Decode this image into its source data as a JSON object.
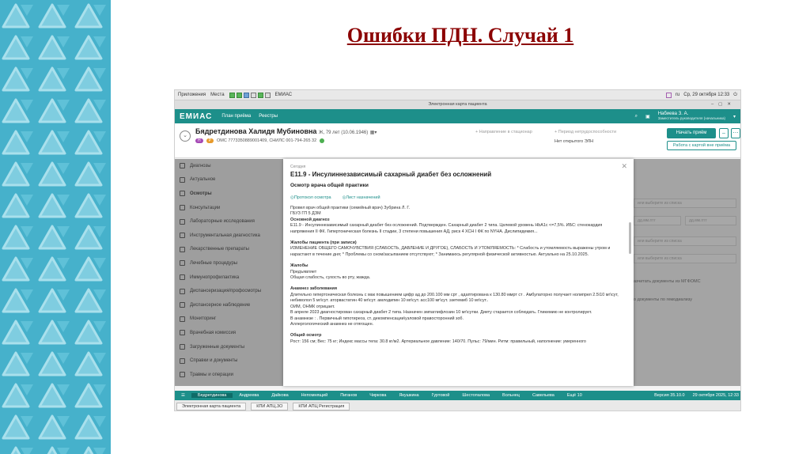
{
  "slide": {
    "title": "Ошибки ПДН. Случай 1"
  },
  "os_bar": {
    "menu": [
      "Приложения",
      "Места"
    ],
    "app_name": "ЕМИАС",
    "locale": "ru",
    "datetime": "Ср, 29 октября 12:33"
  },
  "window": {
    "title": "Электронная карта пациента"
  },
  "app": {
    "logo": "ЕМИАС",
    "nav": [
      "План приёма",
      "Реестры"
    ],
    "user_name": "Набиева З. А.",
    "user_role": "Заместитель руководителя (начальника)"
  },
  "patient": {
    "name": "Бядретдинова Халидя Мубиновна",
    "details": "Ж, 79 лет (10.06.1946)",
    "tags": [
      "Н",
      "Р"
    ],
    "policy": "ОМС 7773350889001409, СНИЛС 001-794-265 32",
    "referral_label": "+ Направление в стационар",
    "disability_label": "+ Период нетрудоспособности",
    "disability_status": "Нет открытого ЭЛН",
    "start_button": "Начать приём",
    "minus_button": "–",
    "work_button": "Работа с картой вне приёма"
  },
  "sidebar": {
    "items": [
      {
        "label": "Диагнозы",
        "active": false
      },
      {
        "label": "Актуальное",
        "active": false
      },
      {
        "label": "Осмотры",
        "active": true
      },
      {
        "label": "Консультации",
        "active": false
      },
      {
        "label": "Лабораторные исследования",
        "active": false
      },
      {
        "label": "Инструментальная диагностика",
        "active": false
      },
      {
        "label": "Лекарственные препараты",
        "active": false
      },
      {
        "label": "Лечебные процедуры",
        "active": false
      },
      {
        "label": "Иммунопрофилактика",
        "active": false
      },
      {
        "label": "Диспансеризация/профосмотры",
        "active": false
      },
      {
        "label": "Диспансерное наблюдение",
        "active": false
      },
      {
        "label": "Мониторинг",
        "active": false
      },
      {
        "label": "Врачебная комиссия",
        "active": false
      },
      {
        "label": "Загруженные документы",
        "active": false
      },
      {
        "label": "Справки и документы",
        "active": false
      },
      {
        "label": "Травмы и операции",
        "active": false
      }
    ]
  },
  "background_fields": {
    "select_1": "или выберите из списка",
    "date_placeholder": "дд.мм.гггг",
    "select_2": "или выберите из списка",
    "select_3": "или выберите из списка",
    "text_1": "азчитать документы из МГФОМС",
    "text_2": "о документы по гемодиализу"
  },
  "modal": {
    "today": "Сегодня",
    "diagnosis": "E11.9 - Инсулиннезависимый сахарный диабет без осложнений",
    "subtitle": "Осмотр врача общей практики",
    "link_protocol": "Протокол осмотра",
    "link_orders": "Лист назначений",
    "doctor": "Провел врач общей практики (семейный врач) Зубрина Л. Г.",
    "org": "ГБУЗ ГП 5 ДЗМ",
    "main_diag_heading": "Основной диагноз",
    "main_diag_text": "E11.9 - Инсулиннезависимый сахарный диабет без осложнений. Подтвержден. Сахарный диабет 2 типа. Целевой уровень HbA1c <=7,5%. ИБС: стенокардия напряжения II ФК. Гипертоническая болезнь II стадии, 3 степени повышения АД, риск 4 ХСН I ФК по NYHA. Дислипидемия...",
    "complaints_heading": "Жалобы пациента (при записи)",
    "complaints_text": "ИЗМЕНЕНИЕ ОБЩЕГО САМОЧУВСТВИЯ (СЛАБОСТЬ, ДАВЛЕНИЕ И ДРУГОЕ), СЛАБОСТЬ И УТОМЛЯЕМОСТЬ: * Слабость и утомляемость выражены утром и нарастают в течение дня; * Проблемы со сном/засыпанием отсутствуют; * Занимаюсь регулярной физической активностью. Актуально на 25.10.2025.",
    "complaints2_heading": "Жалобы",
    "complaints2_line1": "Предъявляет",
    "complaints2_line2": "Общая слабость, сухость во рту, жажда.",
    "anamnesis_heading": "Анамнез заболевания",
    "anamnesis_text": "Длительно гипертоническая болезнь с мак повышением цифр ад до 200.100 мм срт , адаптирована к 130.80 ммрт ст . Амбулаторно получает нолипрел 2.5\\10 мг\\сут, небиволол 5 мг\\сут. аторвастатин 40 мг\\сут. амлодипин 10 мг\\сут. асс100 мг\\сут. эзетемиб 10 мг\\сут..",
    "anamnesis_line2": "ОИМ, ОНМК отрицает.",
    "anamnesis_line3": "В апреле 2023 диагностирован сахарный диабет 2 типа. Назначен эмпаглифлозин 10 мг\\сутки. Диету старается соблюдать. Гликемию не контролирует.",
    "anamnesis_line4": "В анамнезе : . Первичный гипотиреоз, ст. декомпенсации\\узловой правосторонний зоб.",
    "anamnesis_line5": "Аллергологический анамнез не отягощен.",
    "exam_heading": "Общий осмотр",
    "exam_text": "Рост: 156 см; Вес: 75 кг; Индекс массы тела: 30.8 кг/м2. Артериальное давление: 140/70. Пульс: 79/мин. Ритм: правильный, наполнение: умеренного"
  },
  "taskbar": {
    "tabs": [
      "Бядретдинова",
      "Андреева",
      "Дайкова",
      "Непомнящий",
      "Пиганов",
      "Чиркова",
      "Якушкина",
      "Гуртовой",
      "Шестопалова",
      "Вольнец",
      "Савельева",
      "Ещё 10"
    ],
    "version": "Версия 35.10.0",
    "datetime": "29 октября 2025, 12:33"
  },
  "bottom_bar": {
    "items": [
      "Электронная карта пациента",
      "КПИ АПЦ.3О",
      "КПИ АПЦ Регистрация"
    ]
  }
}
